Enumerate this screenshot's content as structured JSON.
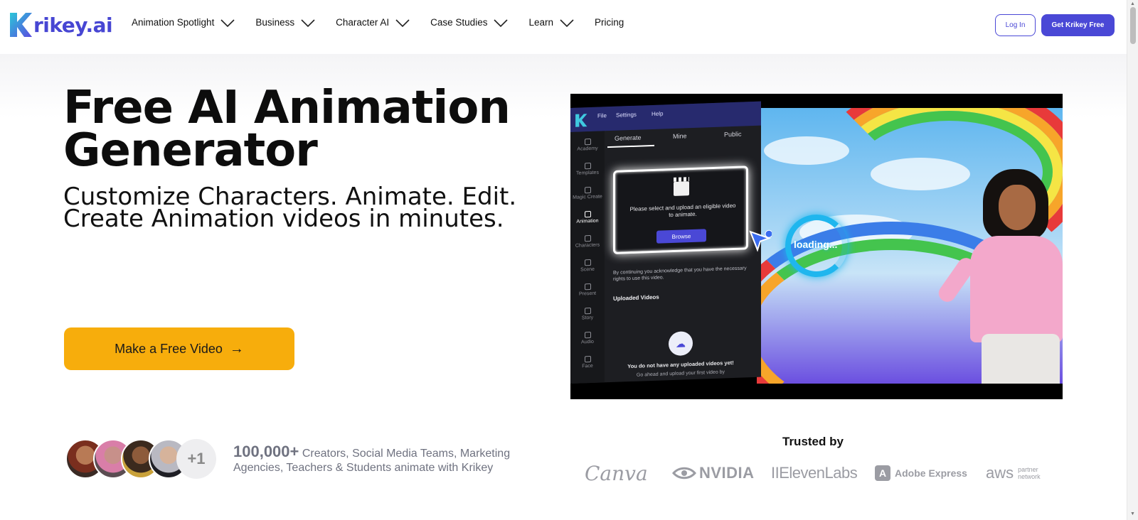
{
  "brand": {
    "logo_text": "rikey.ai",
    "accent": "#4a48d6",
    "cta_color": "#f7ad0c"
  },
  "nav": {
    "menu": [
      {
        "label": "Animation Spotlight",
        "has_dropdown": true
      },
      {
        "label": "Business",
        "has_dropdown": true
      },
      {
        "label": "Character AI",
        "has_dropdown": true
      },
      {
        "label": "Case Studies",
        "has_dropdown": true
      },
      {
        "label": "Learn",
        "has_dropdown": true
      },
      {
        "label": "Pricing",
        "has_dropdown": false
      }
    ],
    "login_label": "Log In",
    "get_free_label": "Get Krikey Free"
  },
  "hero": {
    "title_line1": "Free AI Animation",
    "title_line2": "Generator",
    "subtitle_line1": "Customize Characters. Animate. Edit.",
    "subtitle_line2": "Create Animation videos in minutes.",
    "cta_label": "Make a Free Video",
    "cta_icon": "arrow-right-icon"
  },
  "social_proof": {
    "plus_label": "+1",
    "count": "100,000+",
    "text_line1": "Creators, Social Media Teams, Marketing",
    "text_line2": "Agencies, Teachers & Students animate with Krikey"
  },
  "trusted": {
    "title": "Trusted by",
    "logos": {
      "canva": "Canva",
      "nvidia": "NVIDIA",
      "elevenlabs": "IIElevenLabs",
      "adobe": "Adobe Express",
      "aws": "aws",
      "aws_sub1": "partner",
      "aws_sub2": "network"
    }
  },
  "video": {
    "app_menu": [
      "File",
      "Settings",
      "Help"
    ],
    "tabs": [
      "Generate",
      "Mine",
      "Public"
    ],
    "sidebar": [
      "Academy",
      "Templates",
      "Magic Create",
      "Animation",
      "Characters",
      "Scene",
      "Present",
      "Story",
      "Audio",
      "Face"
    ],
    "active_sidebar": "Animation",
    "upload_text": "Please select and upload an eligible video to animate.",
    "browse_label": "Browse",
    "ack_text": "By continuing you acknowledge that you have the necessary rights to use this video.",
    "uploaded_title": "Uploaded Videos",
    "empty_text": "You do not have any uploaded videos yet!",
    "empty_text2": "Go ahead and upload your first video by",
    "loading_text": "loading..."
  }
}
